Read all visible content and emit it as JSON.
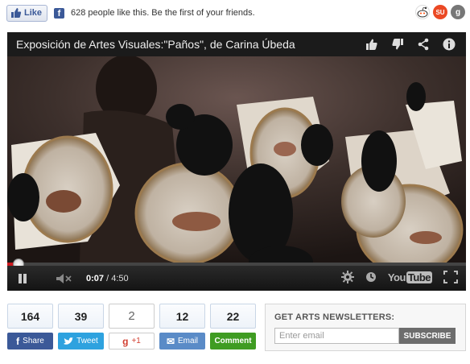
{
  "facebook": {
    "like_label": "Like",
    "like_text": "628 people like this. Be the first of your friends."
  },
  "social_icons": [
    "reddit-icon",
    "stumbleupon-icon",
    "google-plus-icon"
  ],
  "social_labels": {
    "stumbleupon": "SU",
    "gplus": "g"
  },
  "video": {
    "title": "Exposición de Artes Visuales:\"Paños\", de Carina Úbeda",
    "current_time": "0:07",
    "separator": " / ",
    "duration": "4:50",
    "progress_fraction": 0.024,
    "youtube_logo_a": "You",
    "youtube_logo_b": "Tube",
    "accent_color": "#cc181e"
  },
  "share": [
    {
      "key": "fb",
      "count": "164",
      "label": "Share",
      "icon": "f"
    },
    {
      "key": "tw",
      "count": "39",
      "label": "Tweet",
      "icon": "t"
    },
    {
      "key": "gp",
      "count": "2",
      "label": "+1",
      "icon": "g"
    },
    {
      "key": "em",
      "count": "12",
      "label": "Email",
      "icon": "✉"
    },
    {
      "key": "cm",
      "count": "22",
      "label": "Comment",
      "icon": ""
    }
  ],
  "newsletter": {
    "title": "GET ARTS NEWSLETTERS:",
    "placeholder": "Enter email",
    "button": "SUBSCRIBE"
  }
}
